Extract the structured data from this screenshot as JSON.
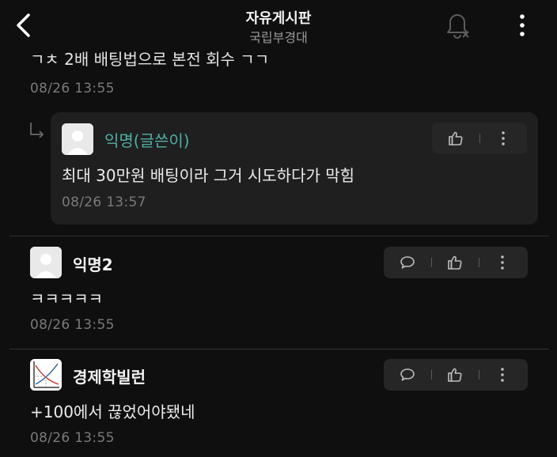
{
  "header": {
    "title": "자유게시판",
    "subtitle": "국립부경대",
    "back_icon": "chevron-left-icon",
    "notification_icon": "bell-off-icon",
    "more_icon": "more-vertical-icon"
  },
  "comments": [
    {
      "partial_text": "ㄱㅊ 2배 배팅법으로 본전 회수 ㄱㄱ",
      "date": "08/26 13:55"
    },
    {
      "is_reply": true,
      "author": "익명(글쓴이)",
      "text": "최대 30만원 배팅이라 그거 시도하다가 막힘",
      "date": "08/26 13:57",
      "actions": [
        "like-icon",
        "more-vertical-icon"
      ]
    },
    {
      "author": "익명2",
      "text": "ㅋㅋㅋㅋㅋ",
      "date": "08/26 13:55",
      "actions": [
        "reply-bubble-icon",
        "like-icon",
        "more-vertical-icon"
      ]
    },
    {
      "author": "경제학빌런",
      "text": "+100에서 끊었어야됐네",
      "date": "08/26 13:55",
      "actions": [
        "reply-bubble-icon",
        "like-icon",
        "more-vertical-icon"
      ]
    }
  ],
  "colors": {
    "background": "#0f0f0f",
    "op_name": "#4fb0a5",
    "reply_card": "#1f1f1f",
    "muted": "#7a7a7a"
  }
}
